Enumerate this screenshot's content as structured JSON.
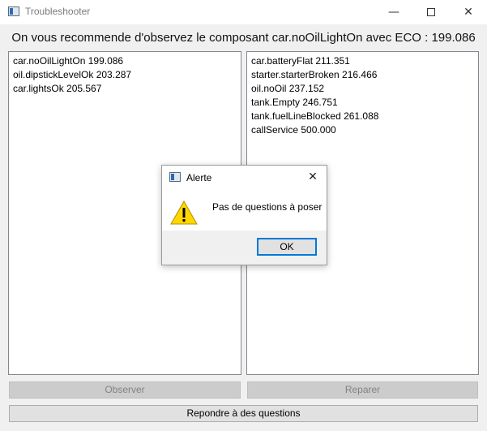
{
  "window": {
    "title": "Troubleshooter",
    "minimize_glyph": "—",
    "close_glyph": "✕"
  },
  "headline": "On vous recommende d'observez le composant car.noOilLightOn avec ECO : 199.086",
  "left_list": [
    "car.noOilLightOn 199.086",
    "oil.dipstickLevelOk 203.287",
    "car.lightsOk 205.567"
  ],
  "right_list": [
    "car.batteryFlat 211.351",
    "starter.starterBroken 216.466",
    "oil.noOil 237.152",
    "tank.Empty 246.751",
    "tank.fuelLineBlocked 261.088",
    "callService 500.000"
  ],
  "buttons": {
    "observer": "Observer",
    "reparer": "Reparer",
    "repondre": "Repondre à des questions"
  },
  "dialog": {
    "title": "Alerte",
    "message": "Pas de questions à poser",
    "ok_label": "OK",
    "close_glyph": "✕",
    "icon": "warning-icon"
  },
  "colors": {
    "focus_border": "#0078d7",
    "warning_yellow": "#ffd700"
  }
}
